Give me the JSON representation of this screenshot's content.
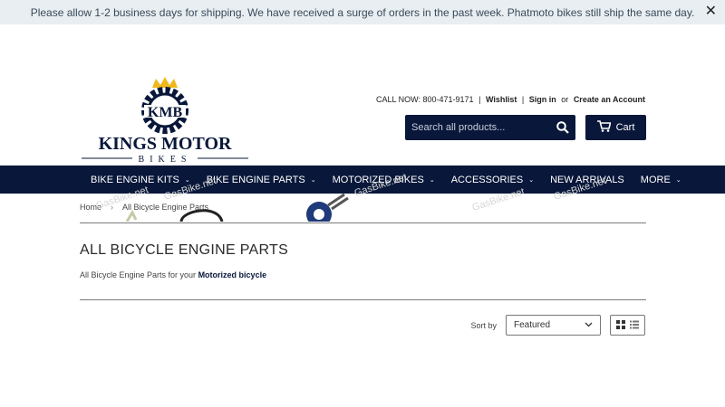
{
  "announcement": {
    "text": "Please allow 1-2 business days for shipping. We have received a surge of orders in the past week. Phatmoto bikes still ship the same day.",
    "close_icon": "close-icon"
  },
  "brand": {
    "monogram": "KMB",
    "name": "KINGS MOTOR",
    "sub": "BIKES"
  },
  "toplinks": {
    "call_label": "CALL NOW:",
    "phone": "800-471-9171",
    "wishlist": "Wishlist",
    "sign_in": "Sign in",
    "or": "or",
    "create_account": "Create an Account"
  },
  "search": {
    "placeholder": "Search all products..."
  },
  "cart": {
    "label": "Cart"
  },
  "nav": {
    "items": [
      {
        "label": "BIKE ENGINE KITS",
        "dropdown": true
      },
      {
        "label": "BIKE ENGINE PARTS",
        "dropdown": true
      },
      {
        "label": "MOTORIZED BIKES",
        "dropdown": true
      },
      {
        "label": "ACCESSORIES",
        "dropdown": true
      },
      {
        "label": "NEW ARRIVALS",
        "dropdown": false
      },
      {
        "label": "MORE",
        "dropdown": true
      }
    ]
  },
  "breadcrumb": {
    "home": "Home",
    "sep": "›",
    "current": "All Bicycle Engine Parts"
  },
  "page": {
    "title": "ALL BICYCLE ENGINE PARTS",
    "desc_prefix": "All Bicycle Engine Parts for your ",
    "desc_link": "Motorized bicycle"
  },
  "sort": {
    "label": "Sort by",
    "selected": "Featured"
  },
  "watermarks": [
    "GasBike.net",
    "GasBike.net",
    "GasBike.net",
    "GasBike.net",
    "GasBike.net"
  ],
  "colors": {
    "navy": "#08173a",
    "announce_bg": "#e8eef1",
    "crown": "#f1b81b"
  }
}
